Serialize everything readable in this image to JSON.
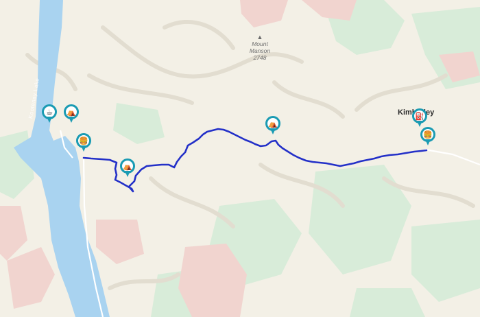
{
  "map": {
    "colors": {
      "background": "#f3f0e6",
      "water": "#a9d3f0",
      "forest": "#d8ecd9",
      "rock": "#f1d4cf",
      "hillshade": "#e7e3d8",
      "route": "#2330c8",
      "marker": "#1a9bb3"
    },
    "labels": {
      "peak_name": "Mount Manson",
      "peak_elevation": "2748",
      "lake": "Kootenay Lake",
      "town": "Kimberley"
    },
    "markers": [
      {
        "type": "coffee",
        "icon": "coffee-icon",
        "glyph": "☕"
      },
      {
        "type": "campground",
        "icon": "tent-icon",
        "glyph": "⛺"
      },
      {
        "type": "food",
        "icon": "burger-icon",
        "glyph": "🍔"
      },
      {
        "type": "campground",
        "icon": "tent-icon",
        "glyph": "⛺"
      },
      {
        "type": "campground",
        "icon": "tent-icon",
        "glyph": "⛺"
      },
      {
        "type": "fuel",
        "icon": "fuel-icon",
        "glyph": "⛽"
      },
      {
        "type": "food",
        "icon": "burger-icon",
        "glyph": "🍔"
      }
    ]
  }
}
